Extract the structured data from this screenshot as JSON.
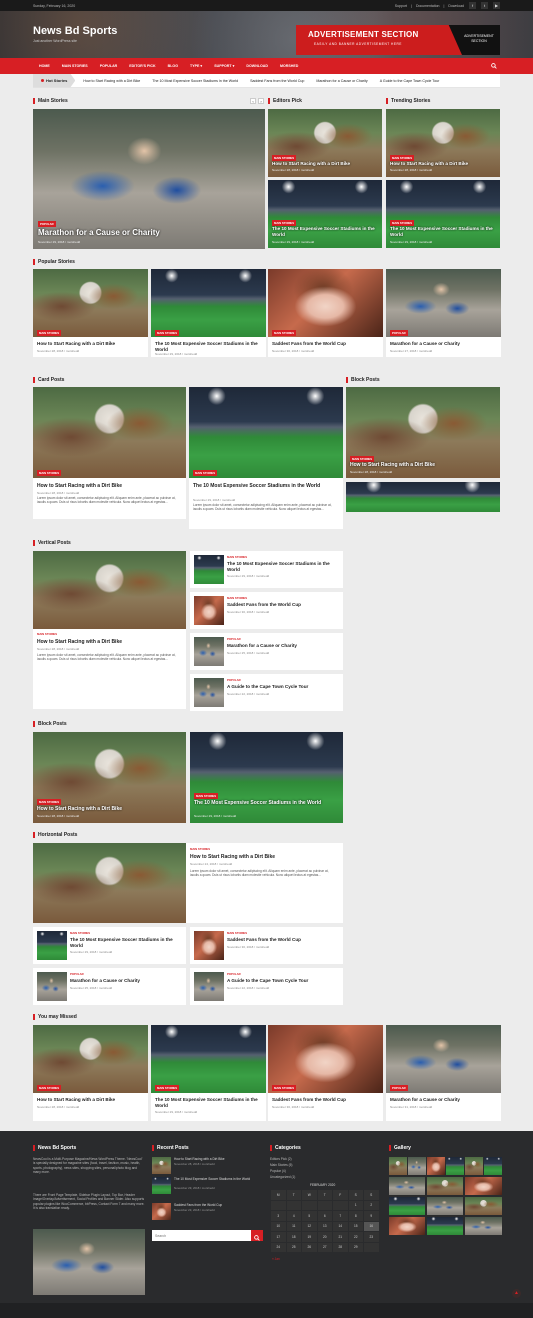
{
  "topbar": {
    "date": "Sunday, February 16, 2020",
    "links": [
      "Support",
      "Documentation",
      "Download"
    ],
    "social": [
      "facebook-icon",
      "twitter-icon",
      "youtube-icon"
    ]
  },
  "site": {
    "title": "News Bd Sports",
    "tagline": "Just another WordPress site"
  },
  "ad": {
    "title": "ADVERTISEMENT SECTION",
    "subtitle": "EASILY AND BANNER ADVERTISEMENT HERE",
    "side": "ADVERTISEMENT SECTION"
  },
  "nav": {
    "items": [
      "HOME",
      "MAIN STORIES",
      "POPULAR",
      "EDITOR'S PICK",
      "BLOG",
      "TYPE",
      "SUPPORT",
      "DOWNLOAD",
      "MORSHED"
    ],
    "type_arrow": "▾",
    "support_arrow": "▾"
  },
  "hot": {
    "label": "Hot Stories",
    "items": [
      "How to Start Racing with a Dirt Bike",
      "The 10 Most Expensive Soccer Stadiums in the World",
      "Saddest Fans from the World Cup",
      "Marathon for a Cause or Charity",
      "A Guide to the Cape Town Cycle Tour"
    ]
  },
  "sections": {
    "main": "Main Stories",
    "editors": "Editors Pick",
    "trending": "Trending Stories",
    "popular": "Popular Stories",
    "card": "Card Posts",
    "block_side": "Block Posts",
    "vertical": "Vertical Posts",
    "block": "Block Posts",
    "horizontal": "Horizontal Posts",
    "missed": "You may Missed"
  },
  "cats": {
    "main": "MAIN STORIES",
    "popular": "POPULAR"
  },
  "posts": {
    "dirt": "How to Start Racing with a Dirt Bike",
    "stadium": "The 10 Most Expensive Soccer Stadiums in the World",
    "fans": "Saddest Fans from the World Cup",
    "marathon": "Marathon for a Cause or Charity",
    "cape": "A Guide to the Cape Town Cycle Tour"
  },
  "meta": {
    "m29": "November 29, 2018 / morshedd",
    "m28": "November 28, 2018 / morshedd",
    "m30": "November 30, 2018 / morshedd",
    "m27": "November 27, 2018 / morshedd",
    "m26": "November 26, 2018 / morshedd",
    "m25": "November 25, 2018 / morshedd",
    "m24": "November 24, 2018 / morshedd",
    "m22": "November 22, 2018 / morshedd",
    "m31": "November 31, 2018 / morshedd"
  },
  "excerpt": "Lorem ipsum dolor sit amet, consectetur adipiscing elit. Aliquam enim ante, placerat ac pulvinar at, iaculis a quam. Duis ut risus lobortis diam molestie vehicula. Nunc aliquet lectus at egestas...",
  "footer": {
    "about_title": "News Bd Sports",
    "about": "NewsCool is a Multi-Purpose Magazine/News WordPress Theme. 'NewsCool' is specially designed for magazine sites (food, travel, fashion, music, health, sports, photography), news sites, shopping sites, personal/photo blog and many more.",
    "about2": "There are Front Page Template, Sidebar Plugin Layout, Top Bar, Header Image/Overlay/Advertisement, Social Profiles and Banner Slider. Also supports popular plugins like WooCommerce, bbPress, Contact Form 7 and many more. It is also translation ready.",
    "recent_title": "Recent Posts",
    "recent": [
      {
        "t": "How to Start Racing with a Dirt Bike",
        "m": "November 28, 2018 / morshedd"
      },
      {
        "t": "The 10 Most Expensive Soccer Stadiums in the World",
        "m": "November 29, 2018 / morshedd"
      },
      {
        "t": "Saddest Fans from the World Cup",
        "m": "November 23, 2018 / morshedd"
      }
    ],
    "search_placeholder": "Search",
    "cat_title": "Categories",
    "cats": [
      "Editors Pick (2)",
      "Main Stories (5)",
      "Popular (4)",
      "Uncategorized (1)"
    ],
    "cal_title": "FEBRUARY 2020",
    "cal_head": [
      "M",
      "T",
      "W",
      "T",
      "F",
      "S",
      "S"
    ],
    "cal_rows": [
      [
        "",
        "",
        "",
        "",
        "",
        "1",
        "2"
      ],
      [
        "3",
        "4",
        "5",
        "6",
        "7",
        "8",
        "9"
      ],
      [
        "10",
        "11",
        "12",
        "13",
        "14",
        "15",
        "16"
      ],
      [
        "17",
        "18",
        "19",
        "20",
        "21",
        "22",
        "23"
      ],
      [
        "24",
        "25",
        "26",
        "27",
        "28",
        "29",
        ""
      ]
    ],
    "cal_prev": "« Jan",
    "gallery_title": "Gallery"
  }
}
